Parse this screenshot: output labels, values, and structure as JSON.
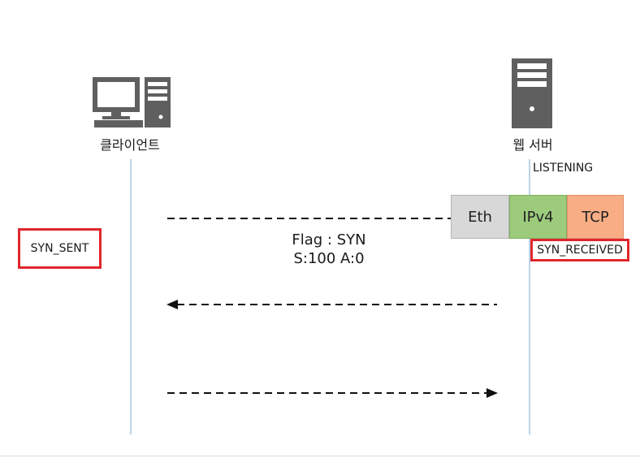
{
  "client": {
    "label": "클라이언트",
    "state": "SYN_SENT"
  },
  "server": {
    "label": "웹 서버",
    "initial_state": "LISTENING",
    "state": "SYN_RECEIVED"
  },
  "packet": {
    "headers": [
      {
        "label": "Eth",
        "color": "#d8d8d8",
        "border": "#b5b5b5"
      },
      {
        "label": "IPv4",
        "color": "#9ccb7c",
        "border": "#7fb05f"
      },
      {
        "label": "TCP",
        "color": "#f8ad85",
        "border": "#e39068"
      }
    ]
  },
  "messages": [
    {
      "direction": "client-to-server",
      "line1": "Flag : SYN",
      "line2": "S:100 A:0"
    },
    {
      "direction": "server-to-client",
      "line1": "",
      "line2": ""
    },
    {
      "direction": "client-to-server",
      "line1": "",
      "line2": ""
    }
  ],
  "colors": {
    "state_box_border": "#e0262e",
    "lifeline": "#a9c4e4",
    "arrow": "#111111"
  }
}
